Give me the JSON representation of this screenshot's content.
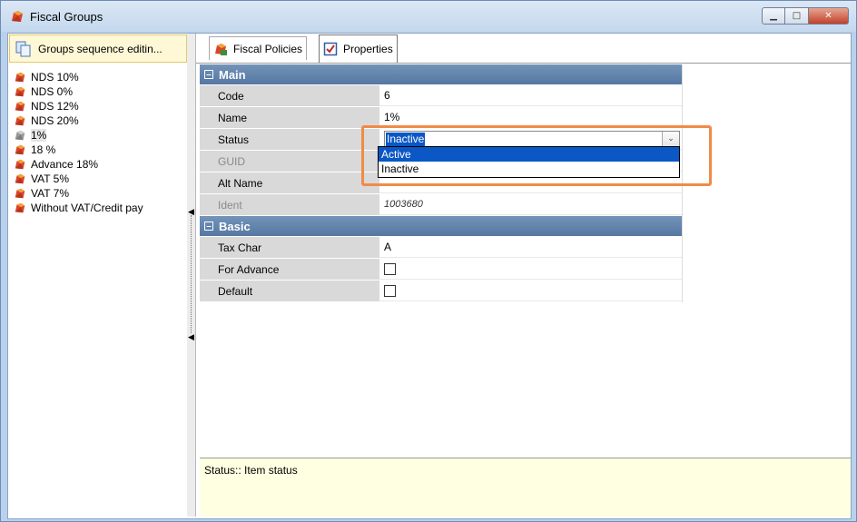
{
  "window": {
    "title": "Fiscal Groups",
    "buttons": {
      "minimize": "▁",
      "maximize": "□",
      "close": "✕"
    }
  },
  "left": {
    "sequence_button": "Groups sequence editin...",
    "groups": [
      {
        "label": "NDS 10%",
        "icon": "group-icon"
      },
      {
        "label": "NDS 0%",
        "icon": "group-icon"
      },
      {
        "label": "NDS 12%",
        "icon": "group-icon"
      },
      {
        "label": "NDS 20%",
        "icon": "group-icon"
      },
      {
        "label": "1%",
        "icon": "group-inactive-icon",
        "selected": true
      },
      {
        "label": "18 %",
        "icon": "group-icon"
      },
      {
        "label": "Advance 18%",
        "icon": "group-icon"
      },
      {
        "label": "VAT 5%",
        "icon": "group-icon"
      },
      {
        "label": "VAT 7%",
        "icon": "group-icon"
      },
      {
        "label": "Without VAT/Credit pay",
        "icon": "group-icon"
      }
    ]
  },
  "tabs": [
    {
      "label": "Fiscal Policies",
      "icon": "fiscal-policies-icon"
    },
    {
      "label": "Properties",
      "icon": "properties-icon",
      "active": true
    }
  ],
  "properties": {
    "main": {
      "header": "Main",
      "code_label": "Code",
      "code_value": "6",
      "name_label": "Name",
      "name_value": "1%",
      "status_label": "Status",
      "status_value": "Inactive",
      "guid_label": "GUID",
      "altname_label": "Alt Name",
      "ident_label": "Ident",
      "ident_value": "1003680"
    },
    "basic": {
      "header": "Basic",
      "taxchar_label": "Tax Char",
      "taxchar_value": "A",
      "foradvance_label": "For Advance",
      "foradvance_checked": false,
      "default_label": "Default",
      "default_checked": false
    }
  },
  "status_dropdown": {
    "options": [
      "Active",
      "Inactive"
    ],
    "highlighted": "Active"
  },
  "help": {
    "text": "Status:: Item status"
  },
  "colors": {
    "category_header": "#5a7ba5",
    "selection": "#0a57c5",
    "callout": "#f08b48",
    "help_bg": "#ffffe1"
  }
}
